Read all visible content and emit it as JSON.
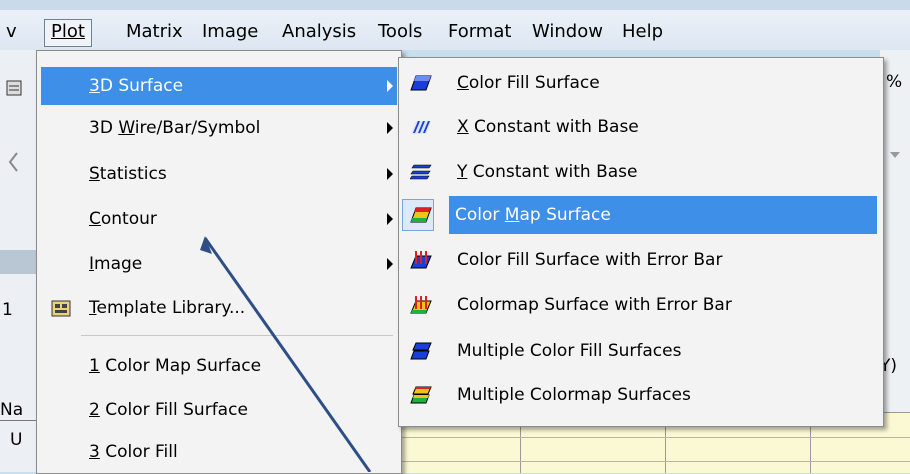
{
  "menubar": {
    "items": [
      {
        "label": "v"
      },
      {
        "label": "Plot"
      },
      {
        "label": "Matrix"
      },
      {
        "label": "Image"
      },
      {
        "label": "Analysis"
      },
      {
        "label": "Tools"
      },
      {
        "label": "Format"
      },
      {
        "label": "Window"
      },
      {
        "label": "Help"
      }
    ]
  },
  "background": {
    "left_fragments": [
      "1",
      "Na",
      "U"
    ],
    "right_fragments": [
      "%",
      "Y)"
    ]
  },
  "plot_menu": {
    "items": [
      {
        "label": "3D Surface",
        "access_key": "3",
        "submenu": true,
        "highlighted": true
      },
      {
        "label": "3D Wire/Bar/Symbol",
        "access_key": "W",
        "submenu": true
      },
      {
        "label": "Statistics",
        "access_key": "S",
        "submenu": true
      },
      {
        "label": "Contour",
        "access_key": "C",
        "submenu": true
      },
      {
        "label": "Image",
        "access_key": "I",
        "submenu": true
      },
      {
        "label": "Template Library...",
        "access_key": "T",
        "icon": "template-library-icon"
      }
    ],
    "recent": [
      {
        "label": "1 Color Map Surface",
        "access_key": "1"
      },
      {
        "label": "2 Color Fill Surface",
        "access_key": "2"
      },
      {
        "label": "3 Color Fill",
        "access_key": "3"
      }
    ]
  },
  "surface_submenu": {
    "items": [
      {
        "label": "Color Fill Surface",
        "icon": "color-fill-surface-icon"
      },
      {
        "label": "X Constant with Base",
        "icon": "x-constant-base-icon"
      },
      {
        "label": "Y Constant with Base",
        "icon": "y-constant-base-icon"
      },
      {
        "label": "Color Map Surface",
        "icon": "color-map-surface-icon",
        "highlighted": true
      },
      {
        "label": "Color Fill Surface with Error Bar",
        "icon": "color-fill-error-bar-icon"
      },
      {
        "label": "Colormap Surface with Error Bar",
        "icon": "colormap-error-bar-icon"
      },
      {
        "label": "Multiple Color Fill Surfaces",
        "icon": "multiple-color-fill-icon"
      },
      {
        "label": "Multiple Colormap Surfaces",
        "icon": "multiple-colormap-icon"
      }
    ]
  },
  "colors": {
    "highlight": "#3d8fe8",
    "menu_bg": "#f3f3f3",
    "annotation_arrow": "#3a5e92"
  }
}
